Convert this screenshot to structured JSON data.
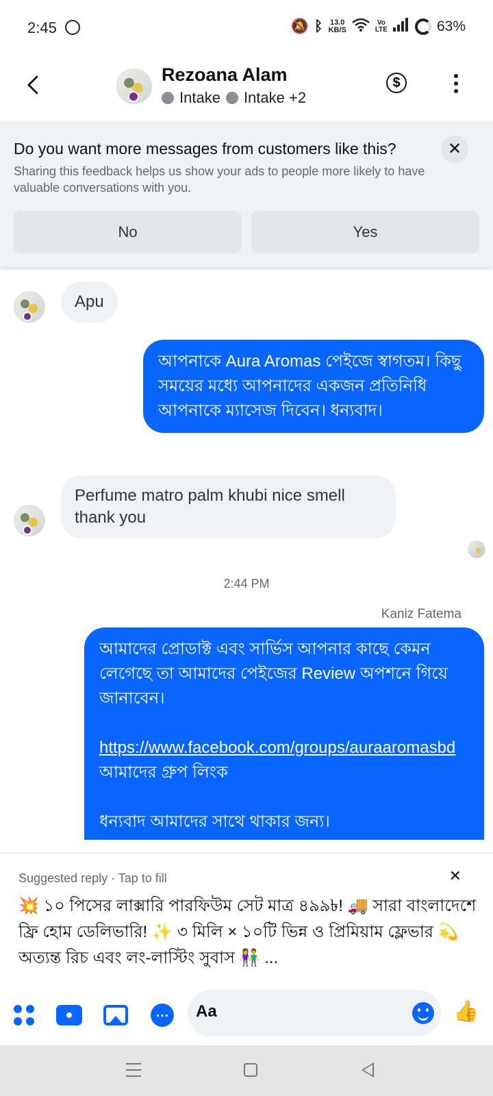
{
  "status_bar": {
    "time": "2:45",
    "speed_value": "13.0",
    "speed_unit": "KB/S",
    "volte_top": "Vo",
    "volte_bottom": "LTE",
    "battery": "63%"
  },
  "header": {
    "name": "Rezoana Alam",
    "tag_1": "Intake",
    "tag_2": "Intake +2",
    "dollar_symbol": "$"
  },
  "feedback": {
    "question": "Do you want more messages from customers like this?",
    "subtitle": "Sharing this feedback helps us show your ads to people more likely to have valuable conversations with you.",
    "close": "✕",
    "no_label": "No",
    "yes_label": "Yes"
  },
  "messages": {
    "m1_text": "Apu",
    "m2_text": "আপনাকে Aura Aromas পেইজে স্বাগতম। কিছু সময়ের মধ্যে আপনাদের একজন প্রতিনিধি আপনাকে ম্যাসেজ দিবেন। ধন্যবাদ।",
    "m3_text": "Perfume matro palm khubi nice smell thank you",
    "timestamp": "2:44 PM",
    "sender": "Kaniz Fatema",
    "m4_line1": "আমাদের প্রোডাক্ট এবং সার্ভিস আপনার কাছে কেমন লেগেছে তা আমাদের পেইজের Review অপশনে গিয়ে জানাবেন।",
    "m4_link": "https://www.facebook.com/groups/auraaromasbd",
    "m4_link_suffix": " আমাদের গ্রুপ লিংক",
    "m4_line3": "ধন্যবাদ আমাদের সাথে থাকার জন্য।"
  },
  "suggested_reply": {
    "header": "Suggested reply · Tap to fill",
    "close": "✕",
    "text": "💥 ১০ পিসের লাক্সারি পারফিউম সেট মাত্র ৪৯৯৳! 🚚 সারা বাংলাদেশে ফ্রি হোম ডেলিভারি! ✨ ৩ মিলি × ১০টি ভিন্ন ও প্রিমিয়াম ফ্লেভার 💫 অত্যন্ত রিচ এবং লং-লাস্টিং সুবাস 👫 ..."
  },
  "composer": {
    "placeholder": "Aa",
    "messenger_glyph": "…",
    "like_glyph": "👍"
  },
  "colors": {
    "accent": "#0866ff",
    "bubble_in": "#f0f2f5"
  },
  "icons": [
    "back-chevron-icon",
    "dollar-icon",
    "more-vertical-icon",
    "close-icon",
    "apps-grid-icon",
    "camera-icon",
    "image-icon",
    "messenger-icon",
    "emoji-icon",
    "like-icon"
  ]
}
